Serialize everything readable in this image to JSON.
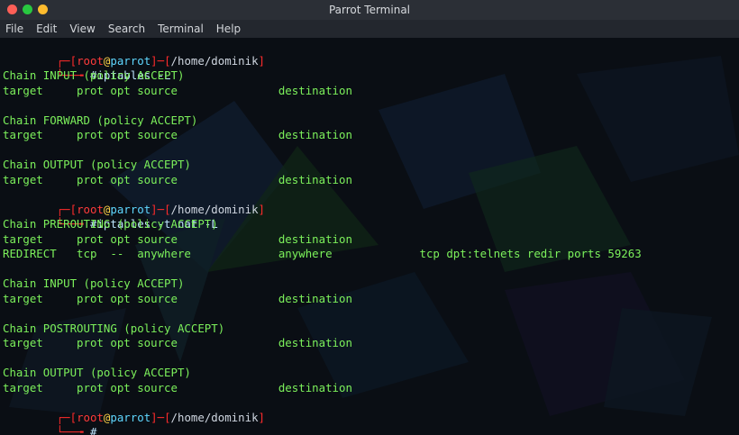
{
  "window": {
    "title": "Parrot Terminal"
  },
  "menu": [
    "File",
    "Edit",
    "View",
    "Search",
    "Terminal",
    "Help"
  ],
  "terminal": {
    "prompts": [
      {
        "user": "root",
        "host": "parrot",
        "path": "/home/dominik",
        "command": "#iptables -L"
      },
      {
        "user": "root",
        "host": "parrot",
        "path": "/home/dominik",
        "command": "#iptables -t nat -L"
      },
      {
        "user": "root",
        "host": "parrot",
        "path": "/home/dominik",
        "command": "#"
      }
    ],
    "output_block_1": [
      "Chain INPUT (policy ACCEPT)",
      "target     prot opt source               destination",
      "",
      "Chain FORWARD (policy ACCEPT)",
      "target     prot opt source               destination",
      "",
      "Chain OUTPUT (policy ACCEPT)",
      "target     prot opt source               destination"
    ],
    "output_block_2": [
      "Chain PREROUTING (policy ACCEPT)",
      "target     prot opt source               destination",
      "REDIRECT   tcp  --  anywhere             anywhere             tcp dpt:telnets redir ports 59263",
      "",
      "Chain INPUT (policy ACCEPT)",
      "target     prot opt source               destination",
      "",
      "Chain POSTROUTING (policy ACCEPT)",
      "target     prot opt source               destination",
      "",
      "Chain OUTPUT (policy ACCEPT)",
      "target     prot opt source               destination"
    ]
  }
}
